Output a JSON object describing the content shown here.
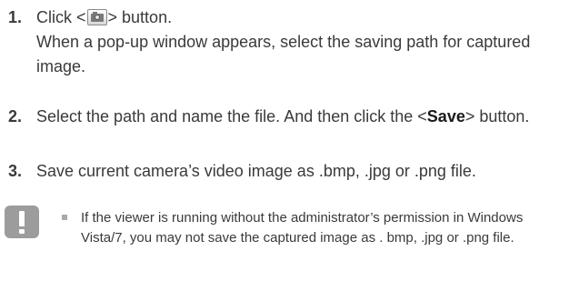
{
  "steps": [
    {
      "number": "1.",
      "line1_prefix": "Click <",
      "line1_suffix": "> button.",
      "line2": "When a pop-up window appears, select the saving path for captured image."
    },
    {
      "number": "2.",
      "text_prefix": "Select the path and name the file. And then click the <",
      "text_bold": "Save",
      "text_suffix": "> button."
    },
    {
      "number": "3.",
      "text": "Save current camera’s video image as .bmp, .jpg or .png file."
    }
  ],
  "note": {
    "icon": "exclamation-icon",
    "text": "If the viewer is running without the administrator’s permission in Windows Vista/7, you may not save the captured image as . bmp, .jpg or .png file."
  },
  "icons": {
    "capture_button": "camera-capture-icon"
  },
  "colors": {
    "text": "#3a3a3a",
    "note_icon_bg": "#9c9c9c"
  }
}
